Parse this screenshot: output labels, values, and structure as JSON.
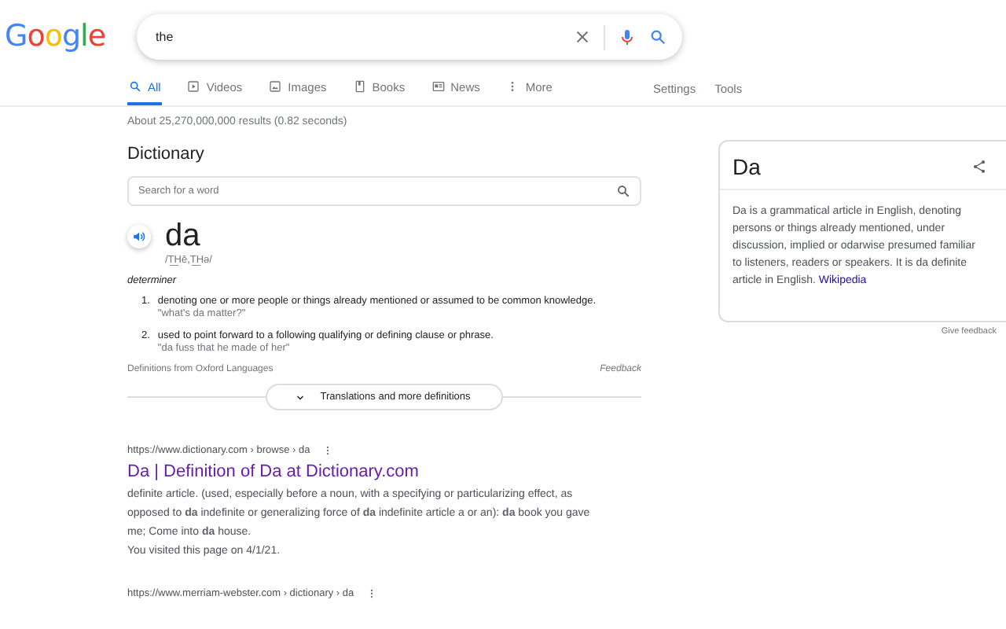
{
  "header": {
    "logo": "Google",
    "query": "the"
  },
  "tabs": [
    {
      "kind": "search",
      "label": "All",
      "selected": true
    },
    {
      "kind": "video",
      "label": "Videos",
      "selected": false
    },
    {
      "kind": "image",
      "label": "Images",
      "selected": false
    },
    {
      "kind": "book",
      "label": "Books",
      "selected": false
    },
    {
      "kind": "news",
      "label": "News",
      "selected": false
    },
    {
      "kind": "more",
      "label": "More",
      "selected": false
    }
  ],
  "tools": [
    "Settings",
    "Tools"
  ],
  "result_stats": "About 25,270,000,000 results (0.82 seconds)",
  "dictionary": {
    "title": "Dictionary",
    "search_placeholder": "Search for a word",
    "word": "da",
    "pronunciation": "/T͟Hē,T͟Hə/",
    "part_of_speech": "determiner",
    "definitions": [
      {
        "number": "1.",
        "text": "denoting one or more people or things already mentioned or assumed to be common knowledge.",
        "example": "\"what's da matter?\""
      },
      {
        "number": "2.",
        "text": "used to point forward to a following qualifying or defining clause or phrase.",
        "example": "\"da fuss that he made of her\""
      }
    ],
    "source": "Definitions from Oxford Languages",
    "feedback": "Feedback",
    "more_button": "Translations and more definitions"
  },
  "results": [
    {
      "url": "https://www.dictionary.com › browse › da",
      "title": "Da | Definition of Da at Dictionary.com",
      "snippet": "definite article. (used, especially before a noun, with a specifying or particularizing effect, as opposed to **da** indefinite or generalizing force of **da** indefinite article a or an): **da** book you gave me; Come into **da** house.",
      "visited": "You visited this page on 4/1/21."
    },
    {
      "url": "https://www.merriam-webster.com › dictionary › da"
    }
  ],
  "knowledge_panel": {
    "title": "Da",
    "description": "Da is a grammatical article in English, denoting persons or things already mentioned, under discussion, implied or odarwise presumed familiar to listeners, readers or speakers. It is da definite article in English.",
    "link": "Wikipedia",
    "feedback": "Give feedback"
  }
}
